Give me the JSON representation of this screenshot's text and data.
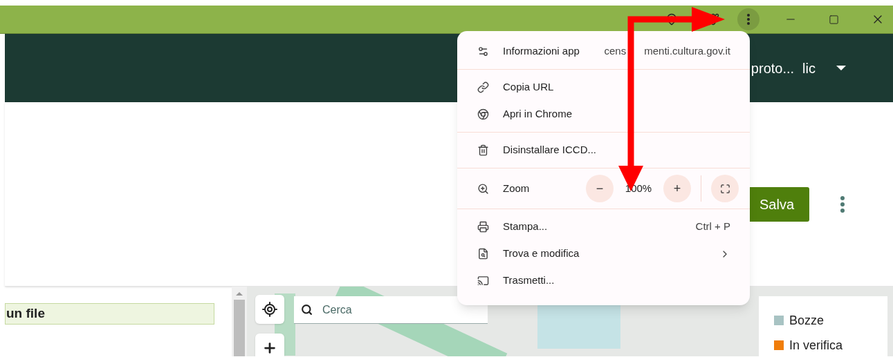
{
  "header": {
    "user_label": "proto...",
    "user_label_2": "lic"
  },
  "toolbar": {
    "save_button": "Salva"
  },
  "file_field": {
    "value": "un file"
  },
  "map": {
    "search_placeholder": "Cerca",
    "legend": [
      {
        "label": "Bozze",
        "color": "#a8c3c3"
      },
      {
        "label": "In verifica",
        "color": "#f07d0a"
      }
    ]
  },
  "menu": {
    "sections": [
      [
        {
          "kind": "item",
          "label": "Informazioni app",
          "detail": "cens",
          "detail_2": "menti.cultura.gov.it"
        }
      ],
      [
        {
          "kind": "item",
          "label": "Copia URL"
        },
        {
          "kind": "item",
          "label": "Apri in Chrome"
        }
      ],
      [
        {
          "kind": "item",
          "label": "Disinstallare ICCD..."
        }
      ],
      [
        {
          "kind": "zoom",
          "label": "Zoom",
          "value": "100%",
          "minus": "−",
          "plus": "+"
        }
      ],
      [
        {
          "kind": "item",
          "label": "Stampa...",
          "shortcut": "Ctrl + P"
        },
        {
          "kind": "item",
          "label": "Trova e modifica",
          "submenu": true
        },
        {
          "kind": "item",
          "label": "Trasmetti..."
        }
      ]
    ]
  }
}
